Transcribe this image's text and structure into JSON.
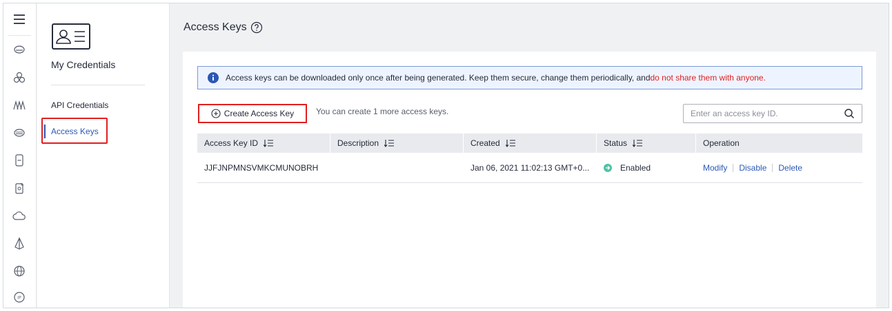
{
  "rail": {
    "icons": [
      "menu-icon",
      "cloud-server-icon",
      "cluster-icon",
      "network-icon",
      "storage-icon",
      "device-icon",
      "image-icon",
      "cloud-icon",
      "deploy-icon",
      "global-icon",
      "ip-icon"
    ]
  },
  "sidebar": {
    "title": "My Credentials",
    "items": [
      {
        "label": "API Credentials"
      },
      {
        "label": "Access Keys"
      }
    ]
  },
  "page": {
    "title": "Access Keys"
  },
  "notice": {
    "text": "Access keys can be downloaded only once after being generated. Keep them secure, change them periodically, and ",
    "warning": "do not share them with anyone."
  },
  "toolbar": {
    "create_label": "Create Access Key",
    "quota_text": "You can create 1 more access keys.",
    "search_placeholder": "Enter an access key ID."
  },
  "table": {
    "columns": [
      "Access Key ID",
      "Description",
      "Created",
      "Status",
      "Operation"
    ],
    "rows": [
      {
        "id": "JJFJNPMNSVMKCMUNOBRH",
        "description": "",
        "created": "Jan 06, 2021 11:02:13 GMT+0...",
        "status": "Enabled",
        "operations": [
          "Modify",
          "Disable",
          "Delete"
        ]
      }
    ]
  },
  "colors": {
    "accent": "#2b58b5",
    "warning": "#e01f1f",
    "enabled": "#50c3a4"
  }
}
